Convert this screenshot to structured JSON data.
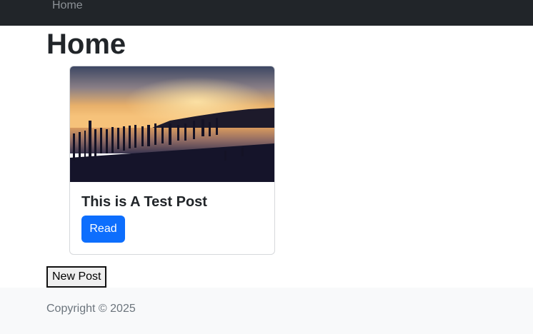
{
  "navbar": {
    "home_link": "Home"
  },
  "main": {
    "title": "Home",
    "posts": [
      {
        "title": "This is A Test Post",
        "read_label": "Read",
        "image": "sunset-pier-photo"
      }
    ],
    "new_post_label": "New Post"
  },
  "footer": {
    "copyright": "Copyright © 2025"
  },
  "colors": {
    "navbar_bg": "#212529",
    "primary_button": "#0d6efd",
    "footer_bg": "#f8f9fa"
  }
}
